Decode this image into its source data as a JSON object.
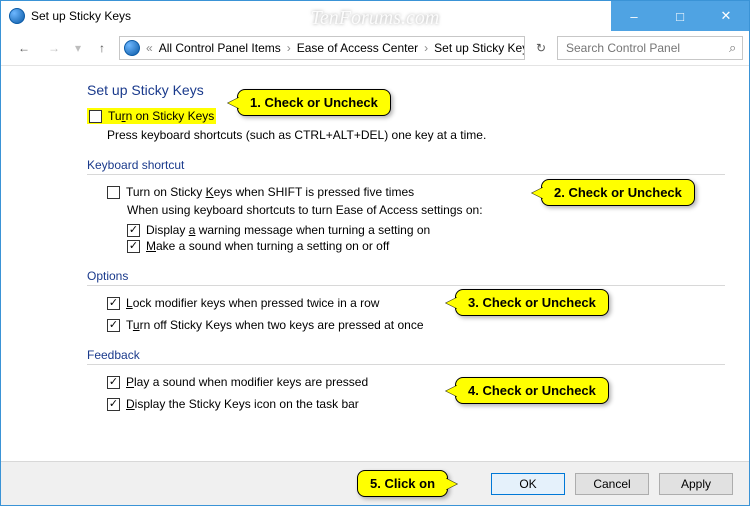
{
  "window": {
    "title": "Set up Sticky Keys",
    "watermark": "TenForums.com"
  },
  "breadcrumb": {
    "items": [
      "All Control Panel Items",
      "Ease of Access Center",
      "Set up Sticky Keys"
    ]
  },
  "search": {
    "placeholder": "Search Control Panel"
  },
  "page": {
    "title": "Set up Sticky Keys",
    "main_toggle": {
      "label": "Turn on Sticky Keys",
      "checked": false
    },
    "main_desc": "Press keyboard shortcuts (such as CTRL+ALT+DEL) one key at a time."
  },
  "sections": {
    "kbshortcut": {
      "header": "Keyboard shortcut",
      "opt1": {
        "label": "Turn on Sticky Keys when SHIFT is pressed five times",
        "checked": false
      },
      "sublabel": "When using keyboard shortcuts to turn Ease of Access settings on:",
      "opt2": {
        "label": "Display a warning message when turning a setting on",
        "checked": true
      },
      "opt3": {
        "label": "Make a sound when turning a setting on or off",
        "checked": true
      }
    },
    "options": {
      "header": "Options",
      "opt1": {
        "label": "Lock modifier keys when pressed twice in a row",
        "checked": true
      },
      "opt2": {
        "label": "Turn off Sticky Keys when two keys are pressed at once",
        "checked": true
      }
    },
    "feedback": {
      "header": "Feedback",
      "opt1": {
        "label": "Play a sound when modifier keys are pressed",
        "checked": true
      },
      "opt2": {
        "label": "Display the Sticky Keys icon on the task bar",
        "checked": true
      }
    }
  },
  "buttons": {
    "ok": "OK",
    "cancel": "Cancel",
    "apply": "Apply"
  },
  "annotations": {
    "a1": "1. Check or Uncheck",
    "a2": "2. Check or Uncheck",
    "a3": "3. Check or Uncheck",
    "a4": "4. Check or Uncheck",
    "a5": "5. Click on"
  }
}
